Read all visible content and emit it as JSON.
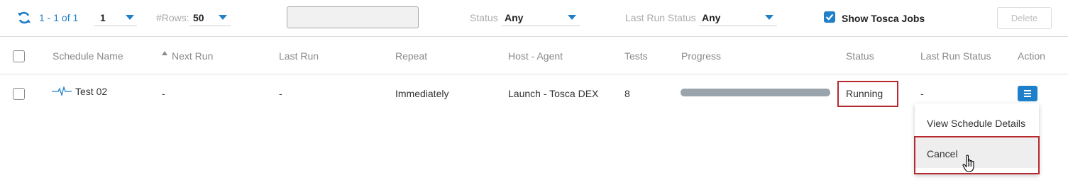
{
  "toolbar": {
    "refresh_icon": "refresh-icon",
    "pagination_text": "1 - 1 of 1",
    "page_value": "1",
    "rows_label": "#Rows:",
    "rows_value": "50",
    "search_value": "",
    "status_label": "Status",
    "status_value": "Any",
    "last_run_status_label": "Last Run Status",
    "last_run_status_value": "Any",
    "show_tosca_label": "Show Tosca Jobs",
    "show_tosca_checked": true,
    "delete_label": "Delete"
  },
  "table": {
    "columns": [
      "Schedule Name",
      "Next Run",
      "Last Run",
      "Repeat",
      "Host - Agent",
      "Tests",
      "Progress",
      "Status",
      "Last Run Status",
      "Action"
    ],
    "sort_indicator_icon": "sort-ascending-icon",
    "rows": [
      {
        "name": "Test 02",
        "name_icon": "heartbeat-icon",
        "next_run": "-",
        "last_run": "-",
        "repeat": "Immediately",
        "host_agent": "Launch - Tosca DEX",
        "tests": "8",
        "progress": 1.0,
        "status": "Running",
        "last_run_status": "-",
        "action_icon": "menu-icon"
      }
    ]
  },
  "action_menu": {
    "items": [
      "View Schedule Details",
      "Cancel"
    ]
  },
  "colors": {
    "accent": "#1f7fc9",
    "highlight_outline": "#b52a2f",
    "progress": "#9aa4ad"
  }
}
